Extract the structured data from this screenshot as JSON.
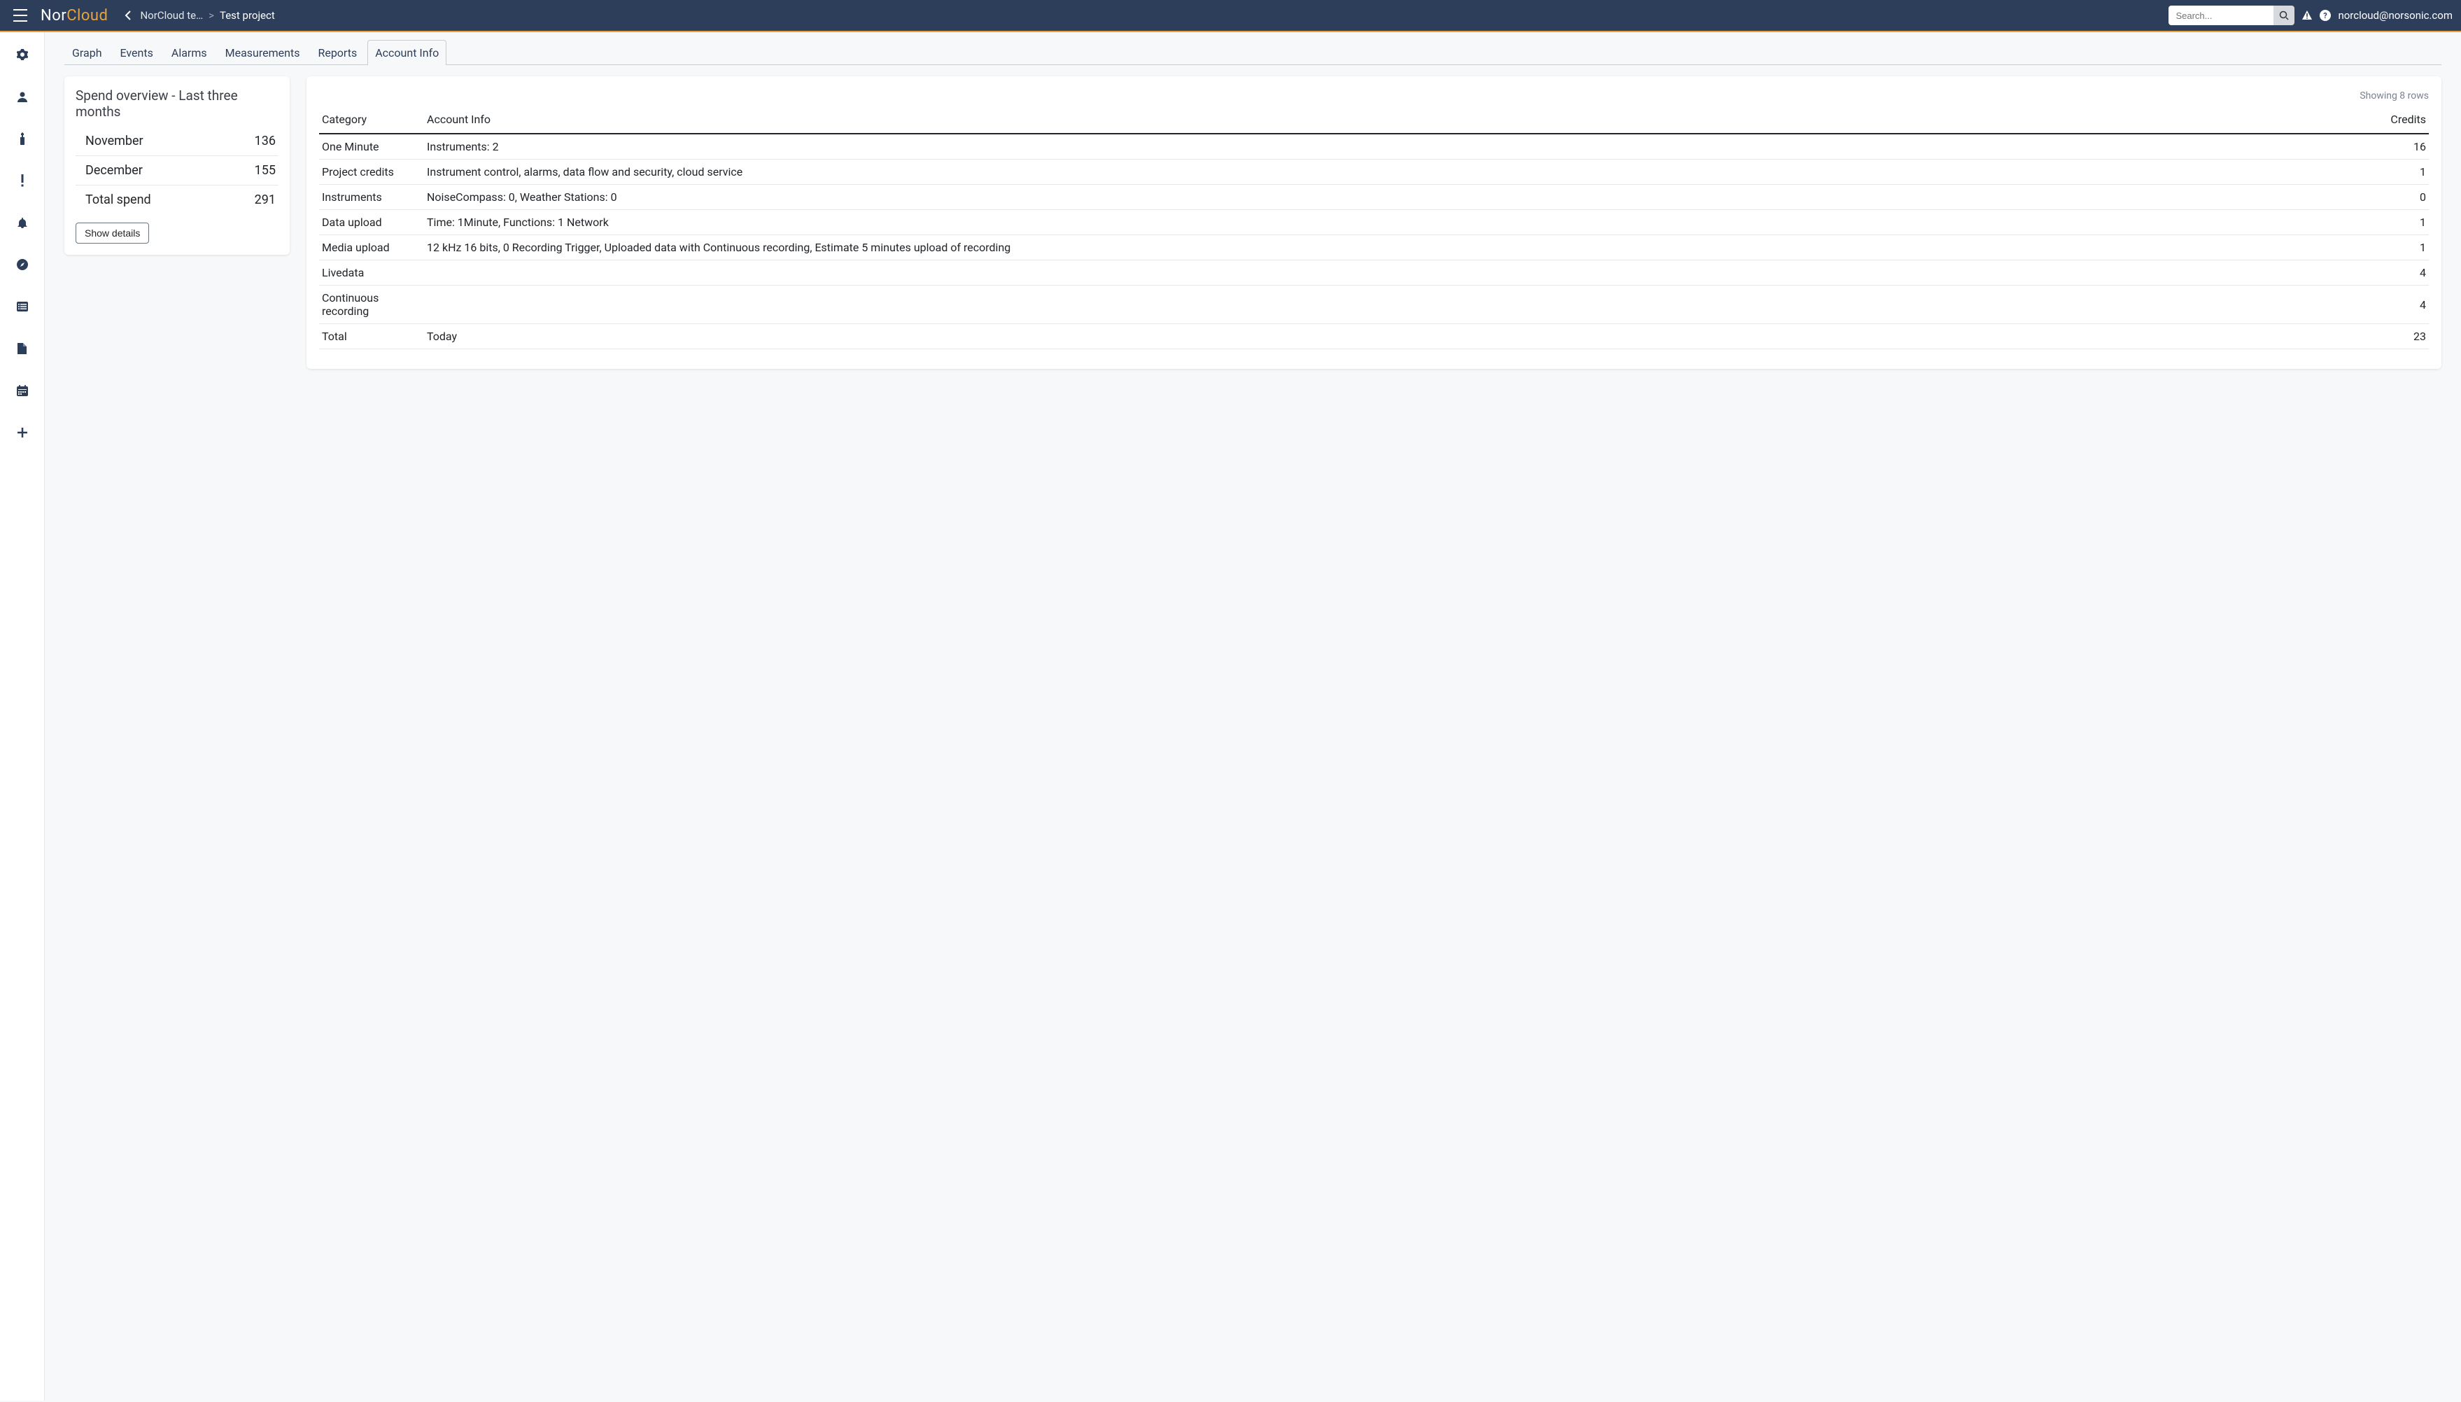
{
  "brand": {
    "part1": "Nor",
    "part2": "Cloud"
  },
  "breadcrumb": {
    "parent": "NorCloud te…",
    "separator": ">",
    "current": "Test project"
  },
  "search": {
    "placeholder": "Search..."
  },
  "user_email": "norcloud@norsonic.com",
  "tabs": [
    "Graph",
    "Events",
    "Alarms",
    "Measurements",
    "Reports",
    "Account Info"
  ],
  "active_tab": "Account Info",
  "spend": {
    "title": "Spend overview - Last three months",
    "rows": [
      {
        "label": "November",
        "value": "136"
      },
      {
        "label": "December",
        "value": "155"
      },
      {
        "label": "Total spend",
        "value": "291"
      }
    ],
    "show_details": "Show details"
  },
  "table": {
    "summary": "Showing 8 rows",
    "headers": [
      "Category",
      "Account Info",
      "Credits"
    ],
    "rows": [
      {
        "category": "One Minute",
        "info": "Instruments: 2",
        "credits": "16"
      },
      {
        "category": "Project credits",
        "info": "Instrument control, alarms, data flow and security, cloud service",
        "credits": "1"
      },
      {
        "category": "Instruments",
        "info": "NoiseCompass: 0, Weather Stations: 0",
        "credits": "0"
      },
      {
        "category": "Data upload",
        "info": "Time: 1Minute, Functions: 1 Network",
        "credits": "1"
      },
      {
        "category": "Media upload",
        "info": "12 kHz 16 bits, 0 Recording Trigger, Uploaded data with Continuous recording, Estimate 5 minutes upload of recording",
        "credits": "1"
      },
      {
        "category": "Livedata",
        "info": "",
        "credits": "4"
      },
      {
        "category": "Continuous recording",
        "info": "",
        "credits": "4"
      },
      {
        "category": "Total",
        "info": "Today",
        "credits": "23"
      }
    ]
  },
  "sidebar_icons": [
    "gear",
    "user",
    "device",
    "exclamation",
    "bell",
    "compass",
    "list",
    "file",
    "calendar",
    "plus"
  ]
}
